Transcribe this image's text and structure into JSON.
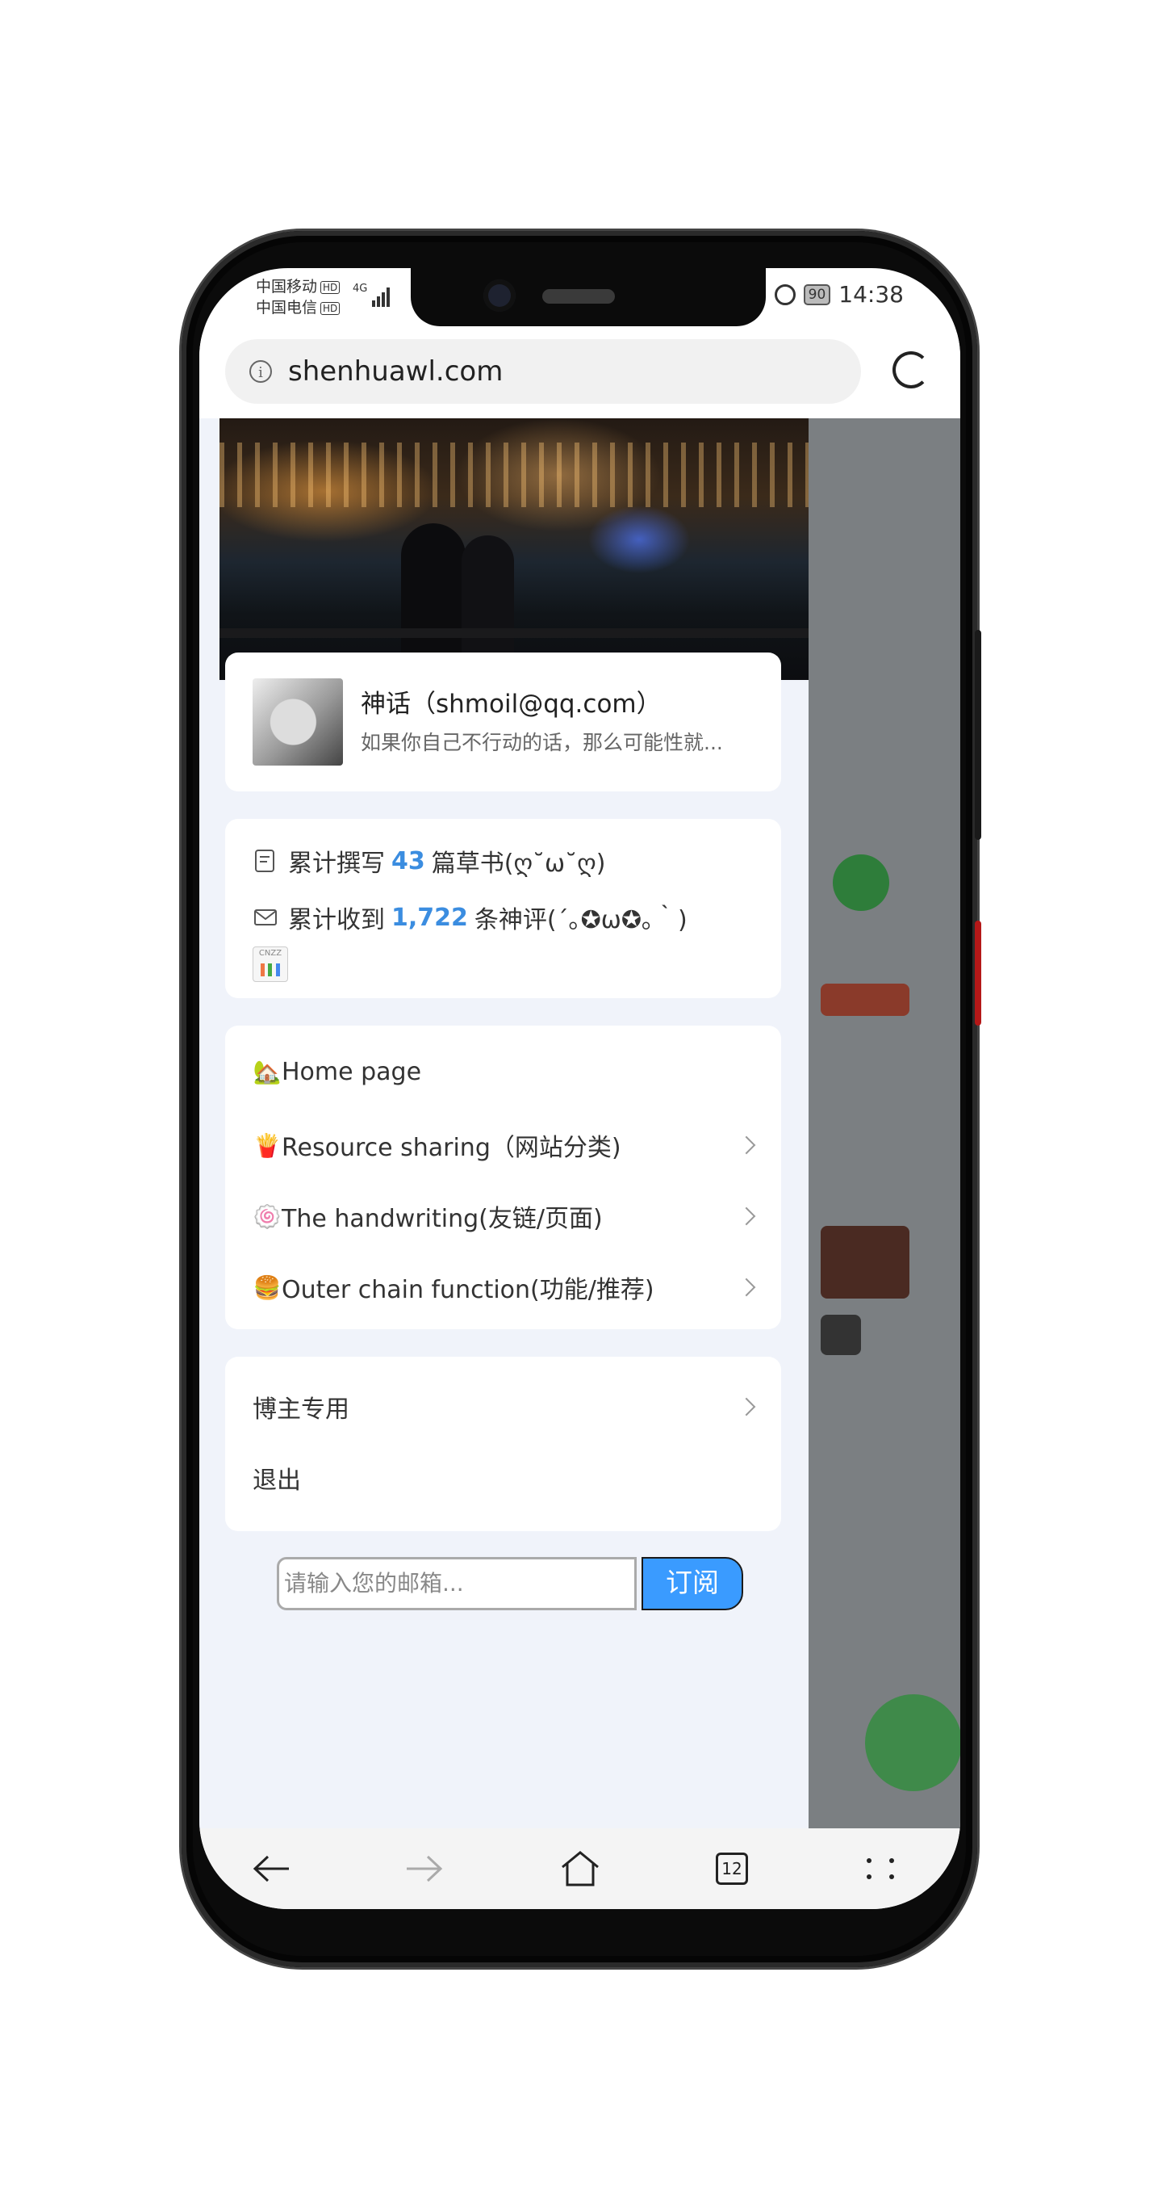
{
  "status": {
    "carrier1": "中国移动",
    "carrier2": "中国电信",
    "hd_label": "HD",
    "network": "4G",
    "battery": "90",
    "time": "14:38"
  },
  "browser": {
    "url": "shenhuawl.com",
    "tab_count": "12"
  },
  "profile": {
    "name": "神话（shmoil@qq.com）",
    "motto": "如果你自己不行动的话，那么可能性就..."
  },
  "stats": {
    "posts_prefix": "累计撰写",
    "posts_count": "43",
    "posts_suffix": "篇草书(ღ˘ω˘ღ)",
    "comments_prefix": "累计收到",
    "comments_count": "1,722",
    "comments_suffix": "条神评(´｡✪ω✪｡｀)",
    "cnzz_label": "CNZZ"
  },
  "menu": {
    "items": [
      {
        "emoji": "🏡",
        "label": "Home page"
      },
      {
        "emoji": "🍟",
        "label": "Resource sharing（网站分类)"
      },
      {
        "emoji": "🍥",
        "label": "The handwriting(友链/页面)"
      },
      {
        "emoji": "🍔",
        "label": "Outer chain function(功能/推荐)"
      }
    ]
  },
  "admin": {
    "blogger_only": "博主专用",
    "logout": "退出"
  },
  "subscribe": {
    "placeholder": "请输入您的邮箱...",
    "button": "订阅"
  },
  "colors": {
    "accent": "#3b8de0",
    "subscribe_button": "#3a9bff",
    "drawer_bg": "#f0f3fa"
  }
}
